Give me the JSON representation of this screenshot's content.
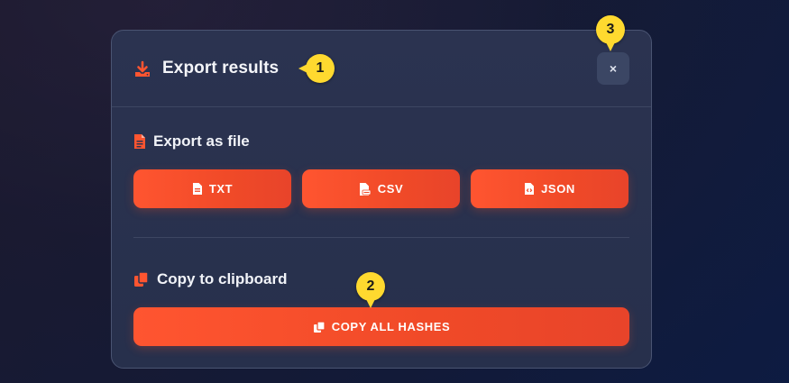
{
  "modal": {
    "title": "Export results",
    "close_label": "×",
    "header_icon": "download-icon"
  },
  "file_section": {
    "label": "Export as file",
    "icon": "file-icon",
    "buttons": [
      {
        "label": "TXT",
        "icon": "file-text-icon"
      },
      {
        "label": "CSV",
        "icon": "file-csv-icon"
      },
      {
        "label": "JSON",
        "icon": "file-code-icon"
      }
    ]
  },
  "clipboard_section": {
    "label": "Copy to clipboard",
    "icon": "copy-icon",
    "button_label": "COPY ALL HASHES",
    "button_icon": "copy-icon"
  },
  "markers": [
    "1",
    "2",
    "3"
  ],
  "colors": {
    "accent": "#ff5530",
    "marker": "#ffd92f",
    "modal_bg": "#2b3350"
  }
}
